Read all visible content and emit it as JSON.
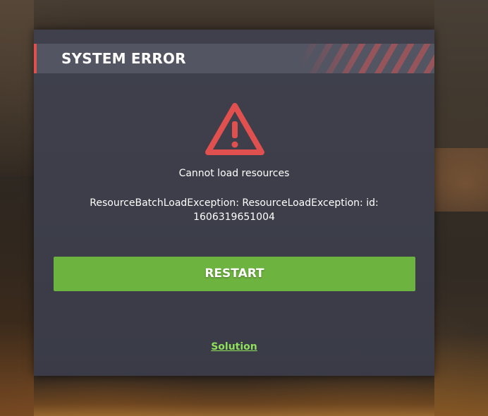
{
  "dialog": {
    "title": "SYSTEM ERROR",
    "icon": "warning-triangle-icon",
    "message": "Cannot load resources",
    "details_line1": "ResourceBatchLoadException: ResourceLoadException: id:",
    "details_line2": "1606319651004",
    "restart_label": "RESTART",
    "solution_label": "Solution"
  },
  "colors": {
    "accent_red": "#e0504f",
    "button_green": "#6db33f",
    "link_green": "#8fe05a",
    "panel_bg": "#3d3e4a",
    "title_bar_bg": "#545563"
  }
}
